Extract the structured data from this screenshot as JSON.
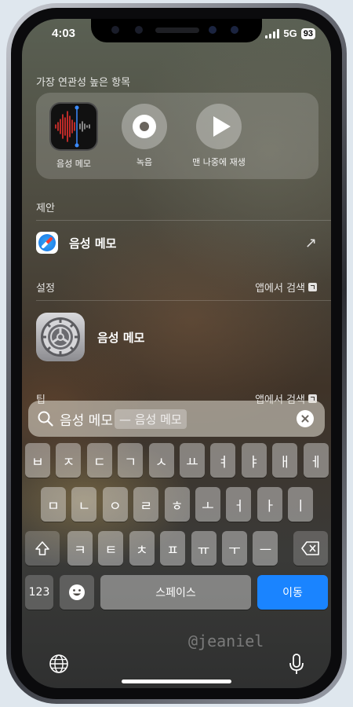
{
  "status": {
    "time": "4:03",
    "network": "5G",
    "battery": "93"
  },
  "top_hits": {
    "label": "가장 연관성 높은 항목",
    "items": [
      {
        "label": "음성 메모",
        "icon": "voice-memos-app-icon"
      },
      {
        "label": "녹음",
        "icon": "record-icon"
      },
      {
        "label": "맨 나중에 재생",
        "icon": "play-icon"
      }
    ]
  },
  "suggestions": {
    "label": "제안",
    "items": [
      {
        "title": "음성 메모",
        "icon": "safari-icon"
      }
    ]
  },
  "settings": {
    "label": "설정",
    "action": "앱에서 검색",
    "items": [
      {
        "title": "음성 메모",
        "icon": "settings-gear-icon"
      }
    ]
  },
  "tips": {
    "label": "팁",
    "action": "앱에서 검색"
  },
  "search": {
    "query": "음성 메모",
    "suggestion": "— 음성 메모"
  },
  "keyboard": {
    "row1": [
      "ㅂ",
      "ㅈ",
      "ㄷ",
      "ㄱ",
      "ㅅ",
      "ㅛ",
      "ㅕ",
      "ㅑ",
      "ㅐ",
      "ㅔ"
    ],
    "row2": [
      "ㅁ",
      "ㄴ",
      "ㅇ",
      "ㄹ",
      "ㅎ",
      "ㅗ",
      "ㅓ",
      "ㅏ",
      "ㅣ"
    ],
    "row3": [
      "ㅋ",
      "ㅌ",
      "ㅊ",
      "ㅍ",
      "ㅠ",
      "ㅜ",
      "ㅡ"
    ],
    "numbers": "123",
    "space": "스페이스",
    "go": "이동"
  },
  "watermark": "@jeaniel",
  "colors": {
    "accent": "#1a84ff",
    "record_red": "#e8322e"
  }
}
